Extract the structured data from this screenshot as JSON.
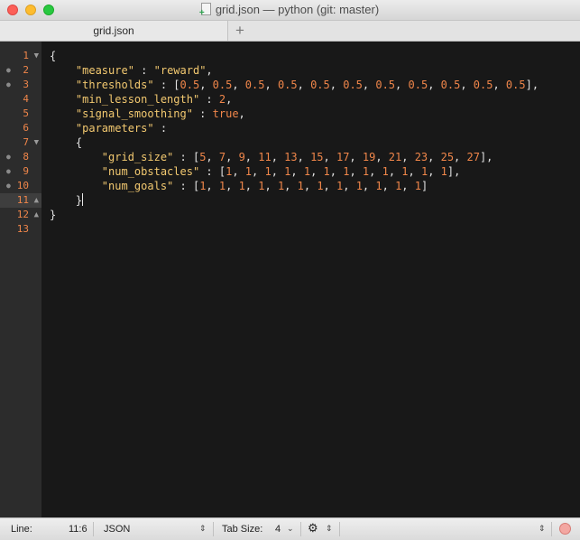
{
  "window": {
    "title": "grid.json — python (git: master)"
  },
  "tabs": [
    {
      "label": "grid.json"
    }
  ],
  "tab_add_label": "+",
  "gutter": {
    "lines": [
      {
        "n": "1",
        "fold": "▼",
        "mark": ""
      },
      {
        "n": "2",
        "fold": "",
        "mark": "●"
      },
      {
        "n": "3",
        "fold": "",
        "mark": "●"
      },
      {
        "n": "4",
        "fold": "",
        "mark": ""
      },
      {
        "n": "5",
        "fold": "",
        "mark": ""
      },
      {
        "n": "6",
        "fold": "",
        "mark": ""
      },
      {
        "n": "7",
        "fold": "▼",
        "mark": ""
      },
      {
        "n": "8",
        "fold": "",
        "mark": "●"
      },
      {
        "n": "9",
        "fold": "",
        "mark": "●"
      },
      {
        "n": "10",
        "fold": "",
        "mark": "●"
      },
      {
        "n": "11",
        "fold": "▲",
        "mark": ""
      },
      {
        "n": "12",
        "fold": "▲",
        "mark": ""
      },
      {
        "n": "13",
        "fold": "",
        "mark": ""
      }
    ],
    "current_line": 11
  },
  "code": {
    "lines": [
      "{",
      "    \"measure\" : \"reward\",",
      "    \"thresholds\" : [0.5, 0.5, 0.5, 0.5, 0.5, 0.5, 0.5, 0.5, 0.5, 0.5, 0.5],",
      "    \"min_lesson_length\" : 2,",
      "    \"signal_smoothing\" : true,",
      "    \"parameters\" :",
      "    {",
      "        \"grid_size\" : [5, 7, 9, 11, 13, 15, 17, 19, 21, 23, 25, 27],",
      "        \"num_obstacles\" : [1, 1, 1, 1, 1, 1, 1, 1, 1, 1, 1, 1],",
      "        \"num_goals\" : [1, 1, 1, 1, 1, 1, 1, 1, 1, 1, 1, 1]",
      "    }",
      "}",
      ""
    ]
  },
  "status": {
    "line_label": "Line:",
    "position": "11:6",
    "syntax": "JSON",
    "tab_size_label": "Tab Size:",
    "tab_size": "4"
  },
  "colors": {
    "editor_bg": "#181818",
    "gutter_bg": "#2c2c2c",
    "string": "#f3c970",
    "number": "#f0864a"
  }
}
